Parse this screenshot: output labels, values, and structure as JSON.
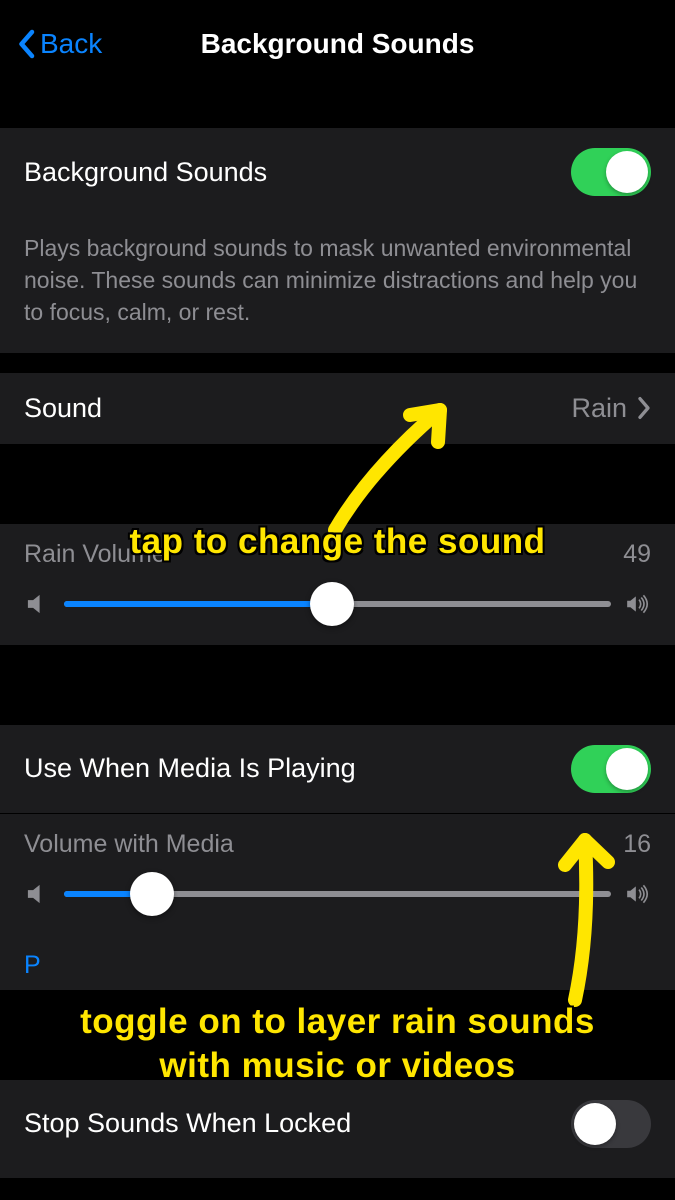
{
  "header": {
    "back_label": "Back",
    "title": "Background Sounds"
  },
  "toggle": {
    "label": "Background Sounds",
    "state": "on",
    "footer": "Plays background sounds to mask unwanted environmental noise. These sounds can minimize distractions and help you to focus, calm, or rest."
  },
  "sound": {
    "label": "Sound",
    "value": "Rain"
  },
  "volume": {
    "label": "Rain Volume",
    "value": "49",
    "percent": 49
  },
  "media": {
    "label": "Use When Media Is Playing",
    "state": "on"
  },
  "media_volume": {
    "label": "Volume with Media",
    "value": "16",
    "percent": 16
  },
  "stop_locked": {
    "label": "Stop Sounds When Locked",
    "state": "off"
  },
  "annotations": {
    "a1": "tap to change the sound",
    "a2": "toggle on to layer rain sounds with music or videos"
  }
}
